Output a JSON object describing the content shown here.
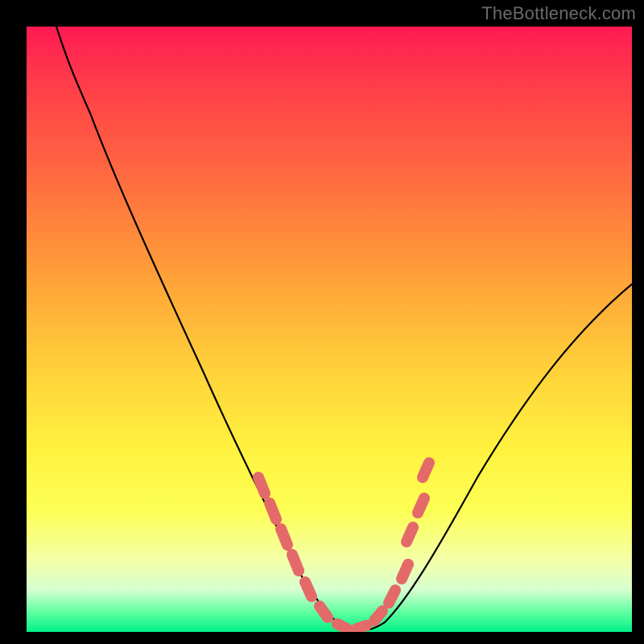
{
  "watermark": "TheBottleneck.com",
  "chart_data": {
    "type": "line",
    "title": "",
    "xlabel": "",
    "ylabel": "",
    "xlim": [
      0,
      100
    ],
    "ylim": [
      0,
      100
    ],
    "grid": false,
    "series": [
      {
        "name": "curve",
        "color": "#000000",
        "x": [
          5,
          8,
          12,
          18,
          25,
          32,
          37,
          42,
          46,
          49,
          52,
          55,
          58,
          62,
          66,
          70,
          75,
          82,
          90,
          100
        ],
        "y": [
          100,
          93,
          85,
          73,
          58,
          42,
          30,
          18,
          8,
          3,
          0,
          0,
          0,
          2,
          7,
          14,
          22,
          33,
          44,
          57
        ]
      },
      {
        "name": "optimal-range-markers",
        "color": "#e46a6a",
        "type": "scatter",
        "x": [
          39,
          41,
          43,
          45,
          48,
          51,
          54,
          57,
          60,
          62,
          62,
          64,
          64,
          66
        ],
        "y": [
          24,
          19,
          15,
          10,
          4,
          1,
          0,
          0,
          1,
          4,
          10,
          14,
          20,
          25
        ]
      }
    ],
    "gradient_stops": [
      {
        "pos": 0.0,
        "color": "#ff1a52"
      },
      {
        "pos": 0.09,
        "color": "#ff3b4a"
      },
      {
        "pos": 0.26,
        "color": "#ff6e3f"
      },
      {
        "pos": 0.42,
        "color": "#ffa338"
      },
      {
        "pos": 0.58,
        "color": "#ffd53a"
      },
      {
        "pos": 0.7,
        "color": "#fff23f"
      },
      {
        "pos": 0.8,
        "color": "#fdff55"
      },
      {
        "pos": 0.88,
        "color": "#f4ffa6"
      },
      {
        "pos": 0.93,
        "color": "#d7ffd0"
      },
      {
        "pos": 0.97,
        "color": "#58ff9e"
      },
      {
        "pos": 1.0,
        "color": "#00f089"
      }
    ],
    "colors": {
      "frame": "#000000",
      "curve": "#000000",
      "markers": "#e46a6a",
      "watermark": "#6a6a6a"
    }
  }
}
